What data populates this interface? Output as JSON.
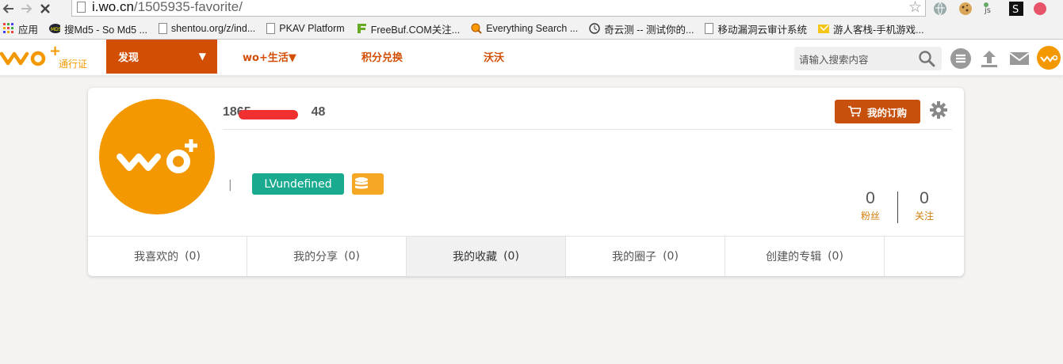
{
  "browser": {
    "url_host": "i.wo.cn",
    "url_path": "/1505935-favorite/",
    "bookmarks": [
      {
        "label": "应用",
        "icon": "apps-grid-icon"
      },
      {
        "label": "搜Md5 - So Md5 ...",
        "icon": "md5-icon"
      },
      {
        "label": "shentou.org/z/ind...",
        "icon": "file-icon"
      },
      {
        "label": "PKAV Platform",
        "icon": "file-icon"
      },
      {
        "label": "FreeBuf.COM关注...",
        "icon": "freebuf-icon"
      },
      {
        "label": "Everything Search ...",
        "icon": "everything-icon"
      },
      {
        "label": "奇云测 -- 测试你的...",
        "icon": "clock-icon"
      },
      {
        "label": "移动漏洞云审计系统",
        "icon": "file-icon"
      },
      {
        "label": "游人客栈-手机游戏...",
        "icon": "folder-bookmark-icon"
      }
    ]
  },
  "header": {
    "logo_sub": "通行证",
    "discover_label": "发现",
    "discover_caret": "▼",
    "nav": [
      "wo+生活▼",
      "积分兑换",
      "沃沃"
    ],
    "search_placeholder": "请输入搜索内容"
  },
  "profile": {
    "username_prefix": "1865",
    "username_suffix": "48",
    "order_button": "我的订购",
    "separator": "|",
    "level_badge": "LVundefined",
    "stats": [
      {
        "value": "0",
        "label": "粉丝"
      },
      {
        "value": "0",
        "label": "关注"
      }
    ]
  },
  "tabs": [
    {
      "label": "我喜欢的",
      "count": "(0)"
    },
    {
      "label": "我的分享",
      "count": "(0)"
    },
    {
      "label": "我的收藏",
      "count": "(0)"
    },
    {
      "label": "我的圈子",
      "count": "(0)"
    },
    {
      "label": "创建的专辑",
      "count": "(0)"
    }
  ],
  "colors": {
    "brand_orange": "#f39800",
    "nav_active": "#d24e05",
    "level_badge": "#1aaa8f",
    "stat_label": "#d27e0a"
  }
}
